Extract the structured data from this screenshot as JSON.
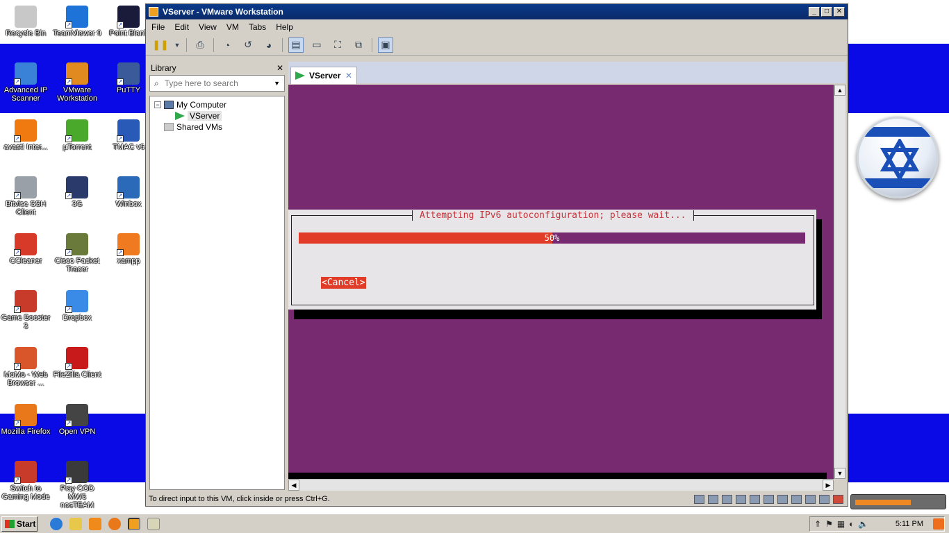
{
  "desktop": {
    "icons": [
      {
        "label": "Recycle Bin",
        "color": "#c8c8c8"
      },
      {
        "label": "TeamViewer 9",
        "color": "#1e73d8"
      },
      {
        "label": "Point Blank",
        "color": "#1a1a3a"
      },
      {
        "label": "Advanced IP Scanner",
        "color": "#3a82d8"
      },
      {
        "label": "VMware Workstation",
        "color": "#e08a20"
      },
      {
        "label": "PuTTY",
        "color": "#3a5a9a"
      },
      {
        "label": "avast! Inter...",
        "color": "#f07a10"
      },
      {
        "label": "µTorrent",
        "color": "#4aa82a"
      },
      {
        "label": "TMAC v6",
        "color": "#2a5ab8"
      },
      {
        "label": "Bitvise SSH Client",
        "color": "#9aa0a8"
      },
      {
        "label": "3G",
        "color": "#2a3a6a"
      },
      {
        "label": "Winbox",
        "color": "#2a6ab8"
      },
      {
        "label": "CCleaner",
        "color": "#d83a2a"
      },
      {
        "label": "Cisco Packet Tracer",
        "color": "#6a7a3a"
      },
      {
        "label": "xampp",
        "color": "#f07a20"
      },
      {
        "label": "Game Booster 3",
        "color": "#c83a2a"
      },
      {
        "label": "Dropbox",
        "color": "#3a8ae8"
      },
      {
        "label": "MoMo - Web Browser ...",
        "color": "#d8562a"
      },
      {
        "label": "FileZilla Client",
        "color": "#c81a1a"
      },
      {
        "label": "Mozilla Firefox",
        "color": "#e8781a"
      },
      {
        "label": "Open VPN",
        "color": "#444444"
      },
      {
        "label": "Switch to Gaming Mode",
        "color": "#c83a2a"
      },
      {
        "label": "Play COD MW3 nosTEAM",
        "color": "#3a3a3a"
      }
    ]
  },
  "window": {
    "title": "VServer - VMware Workstation",
    "controls": {
      "minimize": "_",
      "maximize": "□",
      "close": "✕"
    }
  },
  "menu": [
    "File",
    "Edit",
    "View",
    "VM",
    "Tabs",
    "Help"
  ],
  "library": {
    "title": "Library",
    "close": "✕",
    "search_placeholder": "Type here to search",
    "tree": {
      "root": "My Computer",
      "expander": "−",
      "vm": "VServer",
      "shared": "Shared VMs"
    }
  },
  "tab": {
    "label": "VServer",
    "close": "✕"
  },
  "console": {
    "dialog_title": "Attempting IPv6 autoconfiguration; please wait...",
    "progress_percent": 50,
    "progress_label": "50%",
    "cancel_label": "<Cancel>"
  },
  "statusbar": {
    "hint": "To direct input to this VM, click inside or press Ctrl+G."
  },
  "taskbar": {
    "start_label": "Start",
    "clock": "5:11 PM"
  },
  "colors": {
    "console_bg": "#772a70",
    "accent_red": "#e03c28",
    "dialog_bg": "#e8e5e8",
    "flag_blue": "#0a0ae6"
  }
}
